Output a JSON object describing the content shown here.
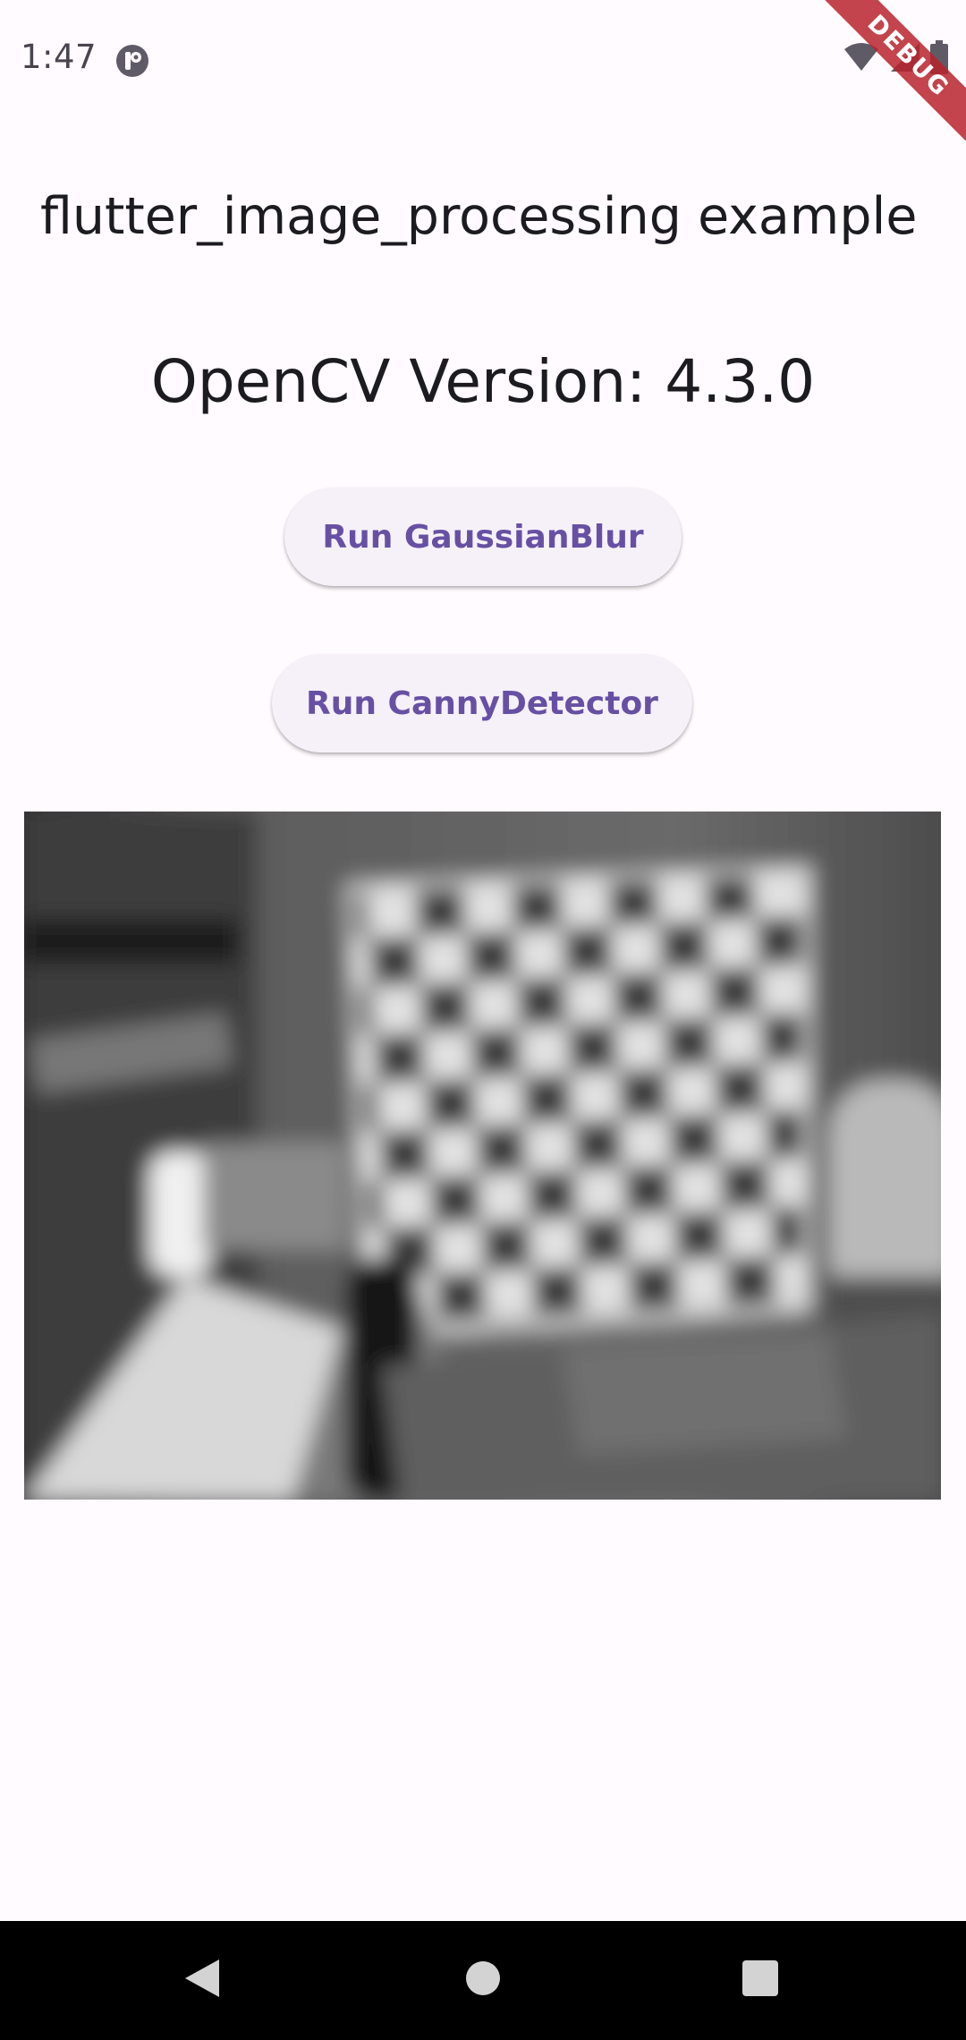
{
  "status_bar": {
    "time": "1:47",
    "app_icon": "app-notification-icon",
    "icons": [
      "wifi-icon",
      "cell-signal-icon",
      "battery-icon"
    ]
  },
  "debug_banner": {
    "label": "DEBUG"
  },
  "app_bar": {
    "title": "flutter_image_processing example"
  },
  "content": {
    "version_text": "OpenCV Version: 4.3.0",
    "buttons": {
      "gaussian_blur": "Run GaussianBlur",
      "canny_detector": "Run CannyDetector"
    },
    "image": {
      "description_icon": "blurred-chessboard-photo"
    }
  },
  "nav_bar": {
    "icons": [
      "back-icon",
      "home-icon",
      "recents-icon"
    ]
  },
  "colors": {
    "background": "#fffbfe",
    "primary": "#6750a4",
    "button_surface": "#f6f1f9",
    "debug_banner": "#b8232d",
    "text": "#1c1b1f"
  }
}
